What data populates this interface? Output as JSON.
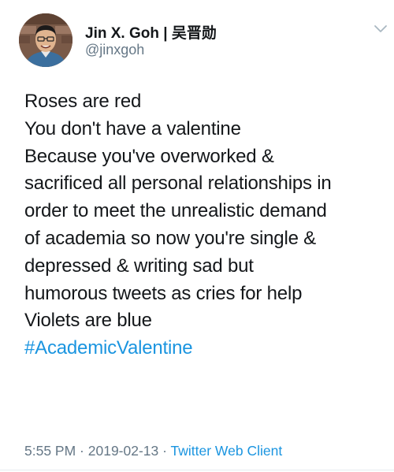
{
  "author": {
    "display_name": "Jin X. Goh | 吴晋勋",
    "handle": "@jinxgoh",
    "avatar_icon": "profile-photo"
  },
  "menu_icon": "chevron-down-icon",
  "tweet": {
    "lines": [
      "Roses are red",
      "You don't have a valentine",
      "Because you've overworked &",
      "sacrificed all personal relationships in",
      "order to meet the unrealistic demand",
      "of academia so now you're single &",
      "depressed & writing sad but",
      "humorous tweets as cries for help",
      "Violets are blue"
    ],
    "hashtag": "#AcademicValentine"
  },
  "meta": {
    "time": "5:55 PM",
    "separator": " · ",
    "date": "2019-02-13",
    "client": "Twitter Web Client"
  },
  "colors": {
    "link": "#1b95e0",
    "secondary_text": "#657786",
    "primary_text": "#14171a"
  }
}
